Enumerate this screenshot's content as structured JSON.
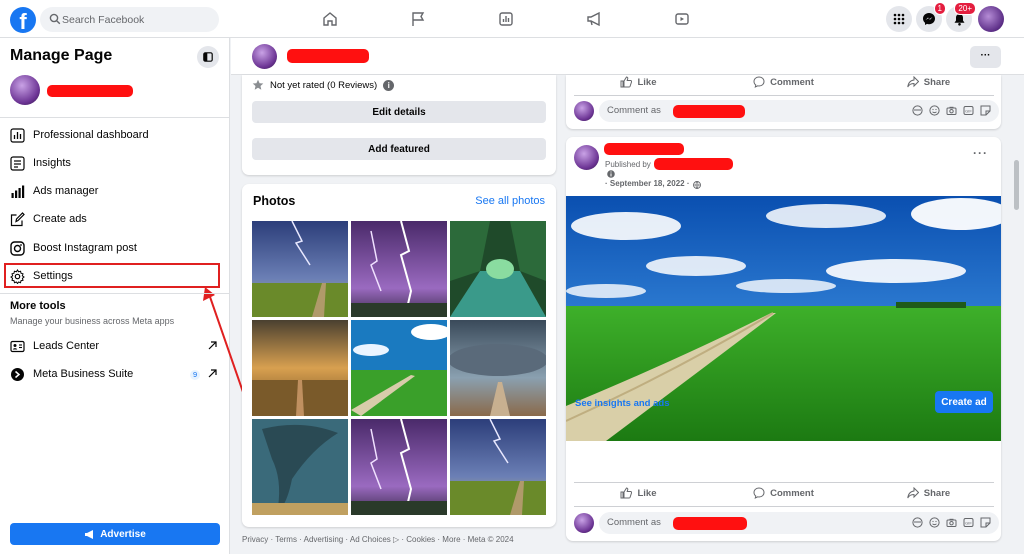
{
  "topbar": {
    "logo": "f",
    "search_placeholder": "Search Facebook",
    "nav_icons": [
      "home-icon",
      "flag-icon",
      "chart-icon",
      "megaphone-icon",
      "video-icon"
    ],
    "messenger_badge": "1",
    "notifications_badge": "20+"
  },
  "sidebar": {
    "title": "Manage Page",
    "items": [
      {
        "label": "Professional dashboard",
        "icon": "dashboard-icon"
      },
      {
        "label": "Insights",
        "icon": "insights-icon"
      },
      {
        "label": "Ads manager",
        "icon": "ads-manager-icon"
      },
      {
        "label": "Create ads",
        "icon": "edit-icon"
      },
      {
        "label": "Boost Instagram post",
        "icon": "instagram-icon"
      },
      {
        "label": "Settings",
        "icon": "gear-icon"
      }
    ],
    "more_tools_title": "More tools",
    "more_tools_subtitle": "Manage your business across Meta apps",
    "tools": [
      {
        "label": "Leads Center",
        "icon": "leads-icon"
      },
      {
        "label": "Meta Business Suite",
        "icon": "meta-suite-icon",
        "badge": "9"
      }
    ],
    "advertise_label": "Advertise"
  },
  "pagebar": {
    "more_label": "···"
  },
  "about": {
    "rating": "Not yet rated (0 Reviews)",
    "edit_details": "Edit details",
    "add_featured": "Add featured"
  },
  "photos": {
    "title": "Photos",
    "see_all": "See all photos"
  },
  "footer": "Privacy · Terms · Advertising · Ad Choices ▷ · Cookies · More · Meta © 2024",
  "post1": {
    "like": "Like",
    "comment": "Comment",
    "share": "Share",
    "comment_as": "Comment as"
  },
  "post2": {
    "published_by": "Published by",
    "date": "· September 18, 2022 ·",
    "see_insights": "See insights and ads",
    "create_ad": "Create ad",
    "like": "Like",
    "comment": "Comment",
    "share": "Share",
    "comment_as": "Comment as"
  },
  "colors": {
    "brand": "#1877f2",
    "highlight": "#e02020",
    "redaction": "#ff1010"
  }
}
